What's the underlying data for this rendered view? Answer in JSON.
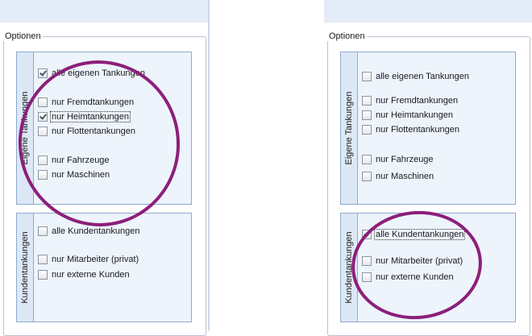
{
  "left": {
    "group_title": "Optionen",
    "own_section": {
      "tab_label": "Eigene Tankungen",
      "items": [
        {
          "label": "alle eigenen Tankungen",
          "checked": true
        },
        {
          "label": "nur Fremdtankungen",
          "checked": false
        },
        {
          "label": "nur Heimtankungen",
          "checked": true
        },
        {
          "label": "nur Flottentankungen",
          "checked": false
        },
        {
          "label": "nur Fahrzeuge",
          "checked": false
        },
        {
          "label": "nur Maschinen",
          "checked": false
        }
      ]
    },
    "customer_section": {
      "tab_label": "Kundentankungen",
      "items": [
        {
          "label": "alle Kundentankungen",
          "checked": false
        },
        {
          "label": "nur Mitarbeiter (privat)",
          "checked": false
        },
        {
          "label": "nur externe Kunden",
          "checked": false
        }
      ]
    }
  },
  "right": {
    "group_title": "Optionen",
    "own_section": {
      "tab_label": "Eigene Tankungen",
      "items": [
        {
          "label": "alle eigenen Tankungen",
          "checked": false
        },
        {
          "label": "nur Fremdtankungen",
          "checked": false
        },
        {
          "label": "nur Heimtankungen",
          "checked": false
        },
        {
          "label": "nur Flottentankungen",
          "checked": false
        },
        {
          "label": "nur Fahrzeuge",
          "checked": false
        },
        {
          "label": "nur Maschinen",
          "checked": false
        }
      ]
    },
    "customer_section": {
      "tab_label": "Kundentankungen",
      "items": [
        {
          "label": "alle Kundentankungen",
          "checked": true
        },
        {
          "label": "nur Mitarbeiter (privat)",
          "checked": false
        },
        {
          "label": "nur externe Kunden",
          "checked": false
        }
      ]
    }
  },
  "colors": {
    "annotation_circle": "#8c1f7a",
    "section_background": "#eef4fc",
    "section_border": "#8eaad0"
  }
}
